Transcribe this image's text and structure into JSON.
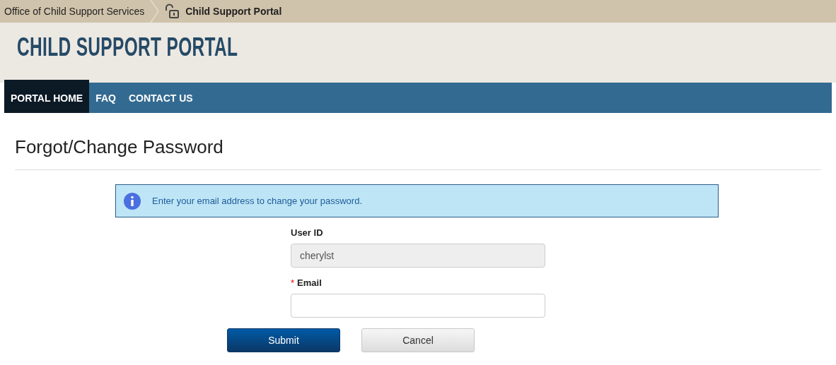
{
  "breadcrumb": [
    {
      "label": "Office of Child Support Services",
      "kind": "link"
    },
    {
      "label": "Child Support Portal",
      "kind": "current"
    }
  ],
  "site_title": "CHILD SUPPORT PORTAL",
  "nav": [
    {
      "label": "PORTAL HOME",
      "selected": true
    },
    {
      "label": "FAQ",
      "selected": false
    },
    {
      "label": "CONTACT US",
      "selected": false
    }
  ],
  "page_title": "Forgot/Change Password",
  "alert": {
    "text": "Enter your email address to change your password."
  },
  "fields": [
    {
      "label": "User ID",
      "value": "cherylst",
      "disabled": true
    },
    {
      "label": "Email",
      "required_mark": "*",
      "disabled": false
    }
  ],
  "buttons": [
    {
      "label": "Submit",
      "kind": "primary"
    },
    {
      "label": "Cancel",
      "kind": "secondary"
    }
  ]
}
